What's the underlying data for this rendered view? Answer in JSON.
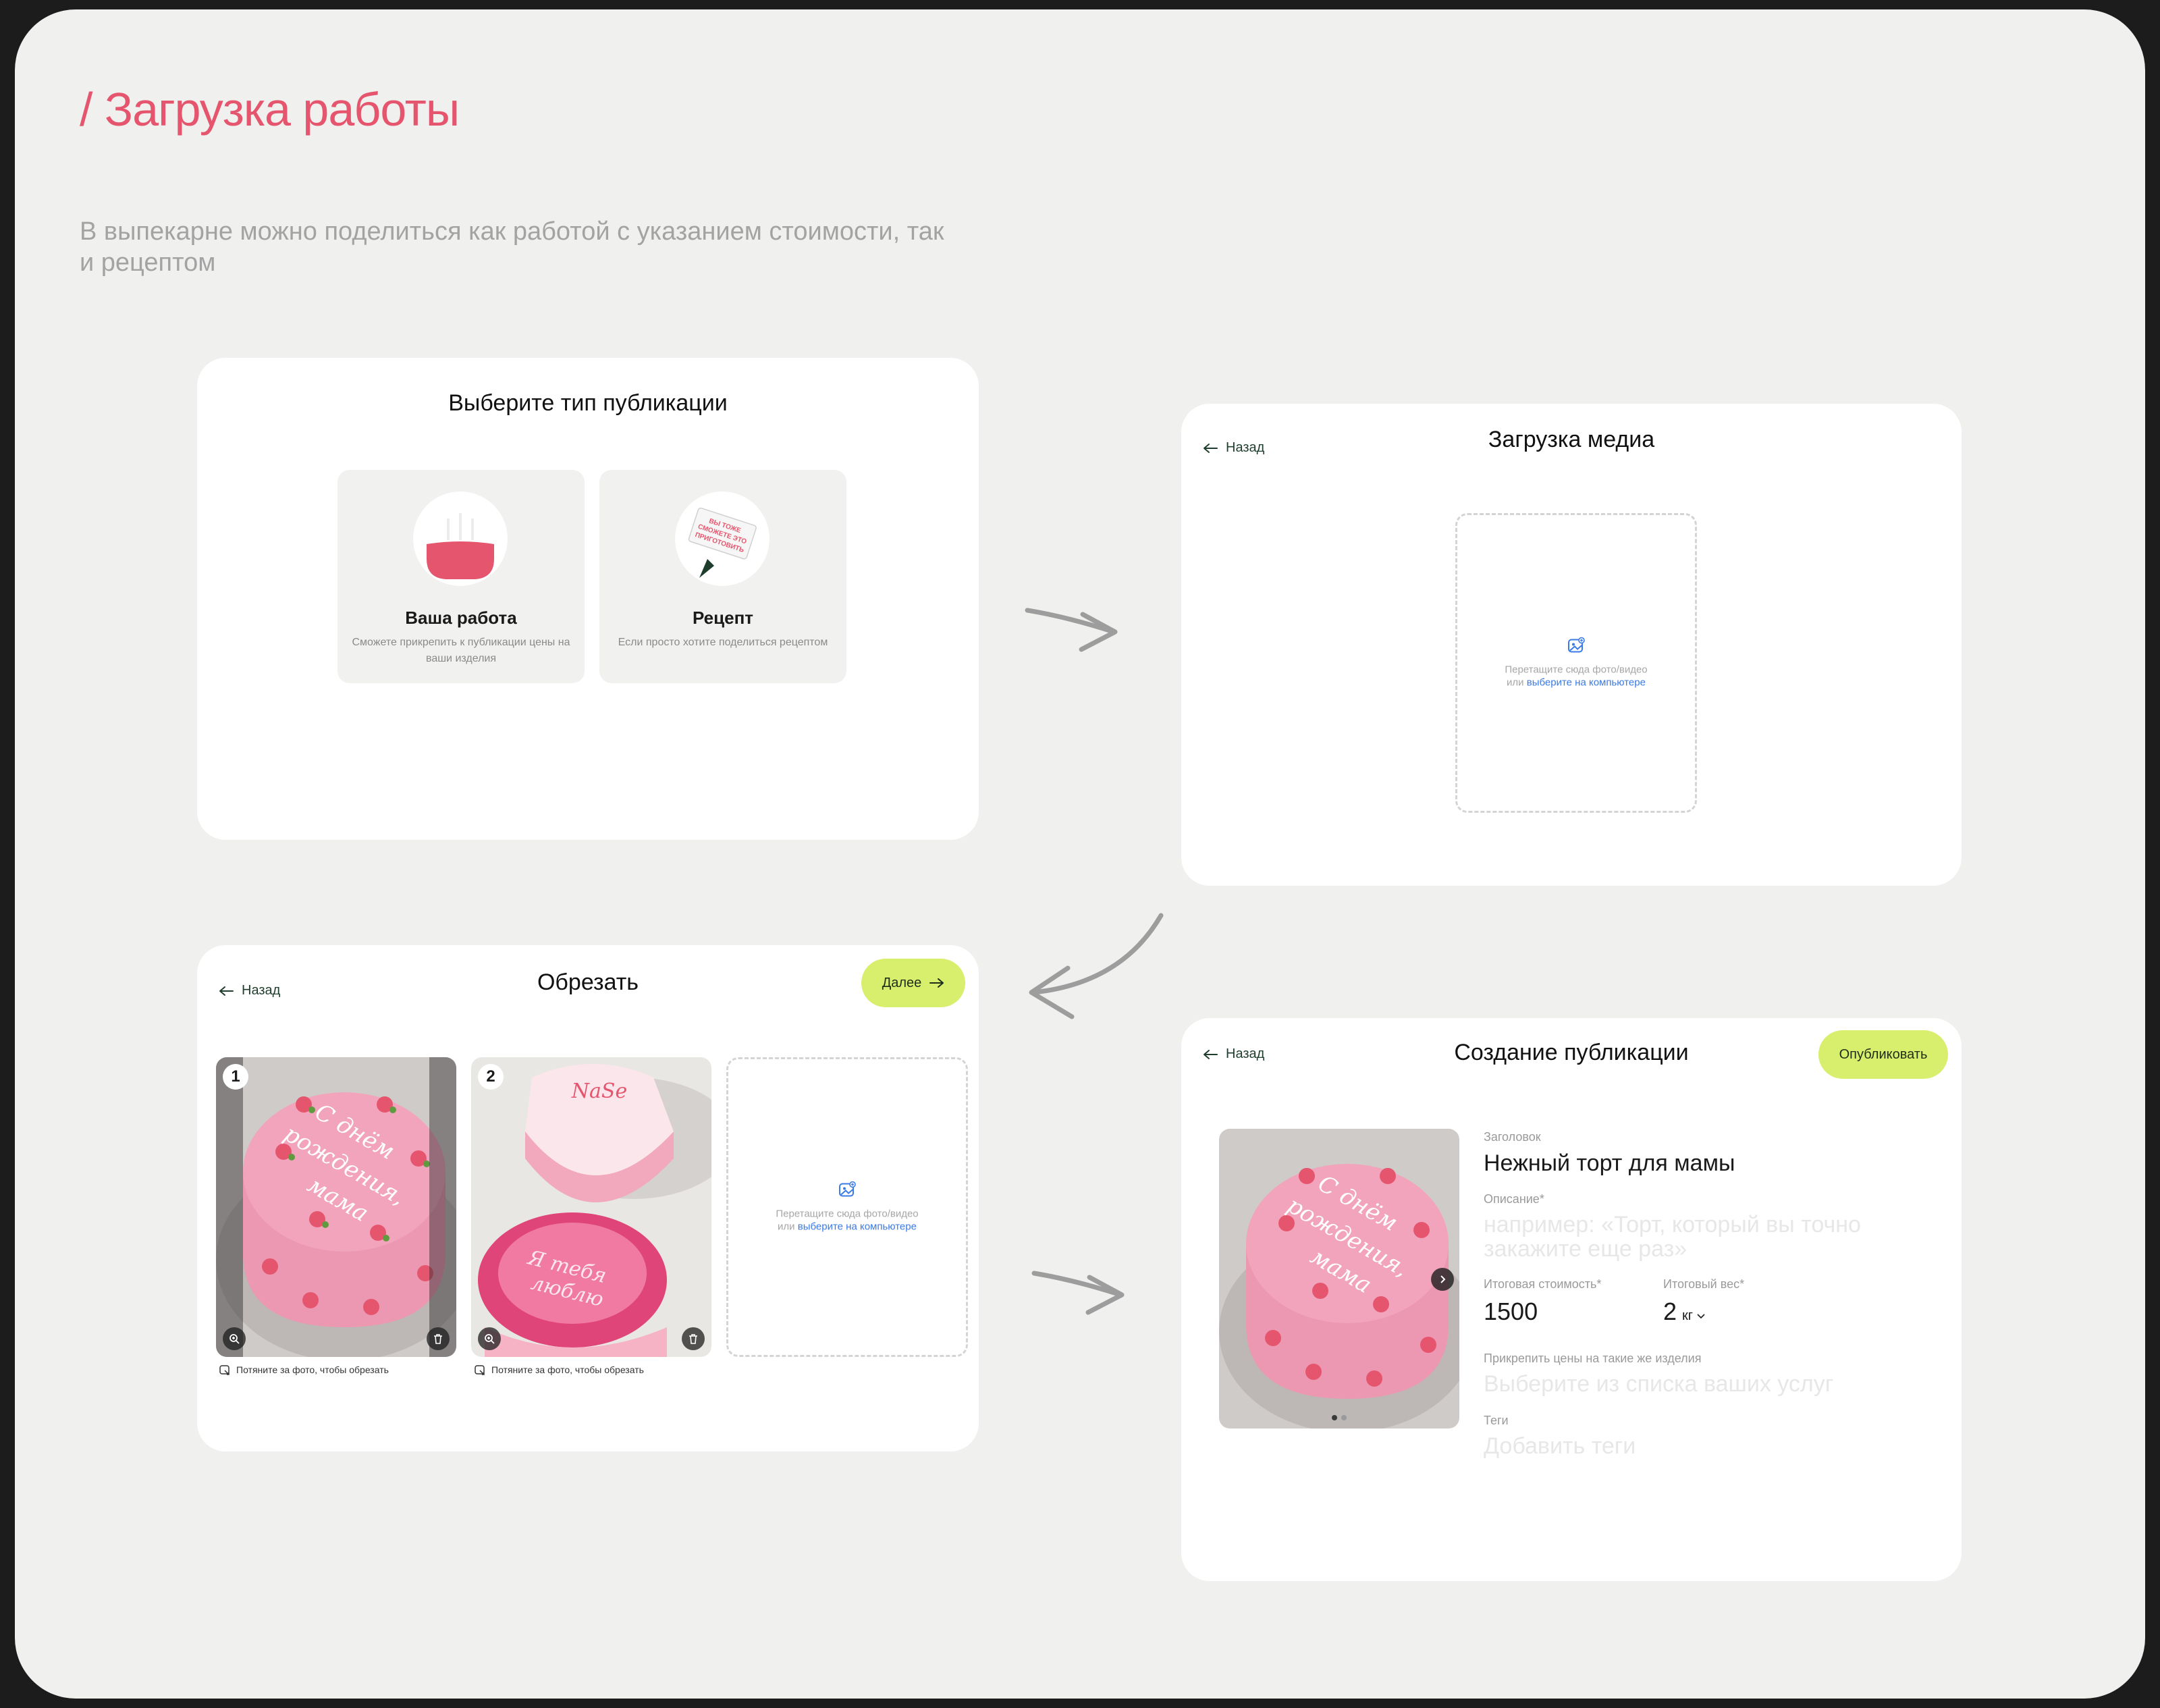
{
  "page": {
    "title": "/ Загрузка работы",
    "intro": "В выпекарне можно поделиться как работой с указанием стоимости, так и рецептом"
  },
  "select_type": {
    "title": "Выберите тип публикации",
    "options": [
      {
        "title": "Ваша работа",
        "description": "Сможете прикрепить к публикации цены на ваши изделия"
      },
      {
        "title": "Рецепт",
        "description": "Если просто хотите поделиться рецептом",
        "sticker": [
          "ВЫ ТОЖЕ",
          "СМОЖЕТЕ ЭТО",
          "ПРИГОТОВИТЬ"
        ]
      }
    ]
  },
  "upload": {
    "back": "Назад",
    "title": "Загрузка медиа",
    "drop_text": "Перетащите сюда фото/видео",
    "drop_or": "или",
    "drop_link": "выберите на компьютере"
  },
  "crop": {
    "back": "Назад",
    "title": "Обрезать",
    "next": "Далее",
    "thumbs": [
      {
        "number": "1",
        "hint": "Потяните за фото, чтобы обрезать",
        "cake_text": [
          "С днём",
          "рождения,",
          "мама"
        ]
      },
      {
        "number": "2",
        "hint": "Потяните за фото, чтобы обрезать",
        "cake_text": [
          "NaSe",
          "Я тебя",
          "люблю"
        ]
      }
    ],
    "drop_text": "Перетащите сюда фото/видео",
    "drop_or": "или",
    "drop_link": "выберите на компьютере"
  },
  "publish": {
    "back": "Назад",
    "title": "Создание публикации",
    "button": "Опубликовать",
    "cake_text": [
      "С днём",
      "рождения,",
      "мама"
    ],
    "fields": {
      "headline_label": "Заголовок",
      "headline_value": "Нежный торт для мамы",
      "description_label": "Описание*",
      "description_placeholder": "например: «Торт, который вы точно закажите еще раз»",
      "price_label": "Итоговая стоимость*",
      "price_value": "1500",
      "weight_label": "Итоговый вес*",
      "weight_value": "2",
      "weight_unit": "кг",
      "attach_label": "Прикрепить цены на такие же изделия",
      "attach_placeholder": "Выберите из списка ваших услуг",
      "tags_label": "Теги",
      "tags_placeholder": "Добавить теги"
    },
    "carousel": {
      "count": 2,
      "active": 1
    }
  },
  "colors": {
    "accent": "#e5566e",
    "primary_button": "#d8ef6e",
    "link": "#3b7be6",
    "canvas": "#f0f0ee",
    "card": "#ffffff"
  }
}
